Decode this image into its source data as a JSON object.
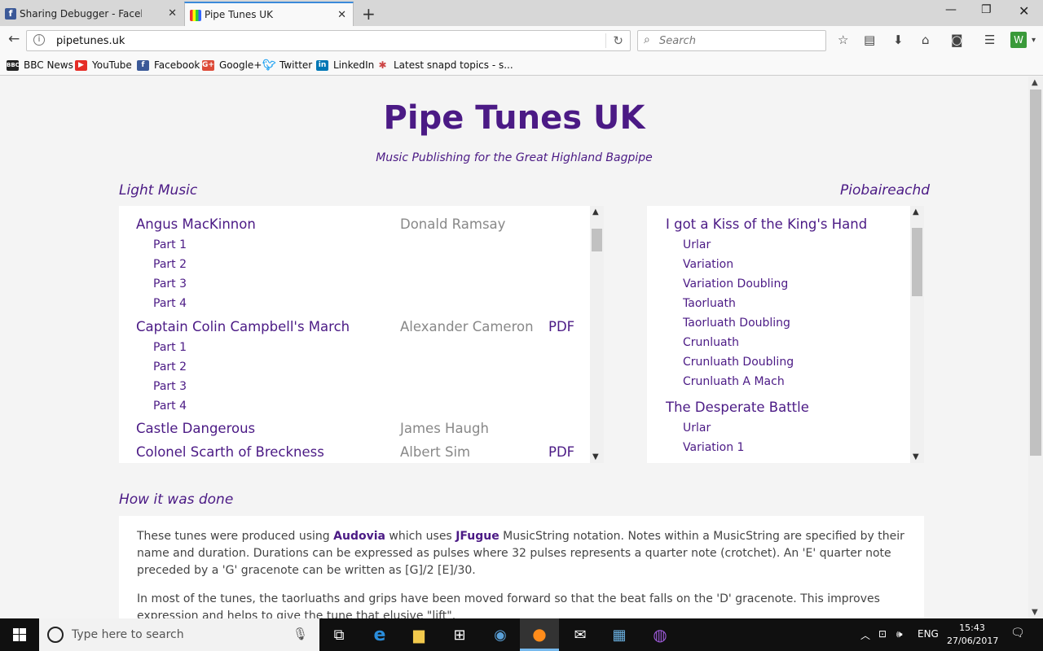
{
  "browser": {
    "tabs": [
      {
        "title": "Sharing Debugger - Facebook",
        "active": false
      },
      {
        "title": "Pipe Tunes UK",
        "active": true
      }
    ],
    "url": "pipetunes.uk",
    "search_placeholder": "Search",
    "bookmarks": [
      "BBC News",
      "YouTube",
      "Facebook",
      "Google+",
      "Twitter",
      "LinkedIn",
      "Latest snapd topics - s..."
    ]
  },
  "site": {
    "title": "Pipe Tunes UK",
    "tagline": "Music Publishing for the Great Highland Bagpipe"
  },
  "light_music": {
    "heading": "Light Music",
    "tunes": [
      {
        "name": "Angus MacKinnon",
        "composer": "Donald Ramsay",
        "pdf": "",
        "parts": [
          "Part 1",
          "Part 2",
          "Part 3",
          "Part 4"
        ]
      },
      {
        "name": "Captain Colin Campbell's March",
        "composer": "Alexander Cameron",
        "pdf": "PDF",
        "parts": [
          "Part 1",
          "Part 2",
          "Part 3",
          "Part 4"
        ]
      },
      {
        "name": "Castle Dangerous",
        "composer": "James Haugh",
        "pdf": "",
        "parts": []
      },
      {
        "name": "Colonel Scarth of Breckness",
        "composer": "Albert Sim",
        "pdf": "PDF",
        "parts": []
      }
    ]
  },
  "piobaireachd": {
    "heading": "Piobaireachd",
    "tunes": [
      {
        "name": "I got a Kiss of the King's Hand",
        "parts": [
          "Urlar",
          "Variation",
          "Variation Doubling",
          "Taorluath",
          "Taorluath Doubling",
          "Crunluath",
          "Crunluath Doubling",
          "Crunluath A Mach"
        ]
      },
      {
        "name": "The Desperate Battle",
        "parts": [
          "Urlar",
          "Variation 1"
        ]
      }
    ]
  },
  "how": {
    "heading": "How it was done",
    "p1": {
      "t1": "These tunes were produced using ",
      "link1": "Audovia",
      "t2": " which uses ",
      "link2": "JFugue",
      "t3": " MusicString notation.  Notes within a MusicString are specified by their name and duration.  Durations can be expressed as pulses where 32 pulses represents a quarter note (crotchet).  An 'E' quarter note preceded by a 'G' gracenote can be written as [G]/2 [E]/30."
    },
    "p2": "In most of the tunes, the taorluaths and grips have been moved forward so that the beat falls on the 'D' gracenote.  This improves expression and helps to give the tune that elusive \"lift\"."
  },
  "taskbar": {
    "search_placeholder": "Type here to search",
    "language": "ENG",
    "time": "15:43",
    "date": "27/06/2017"
  }
}
